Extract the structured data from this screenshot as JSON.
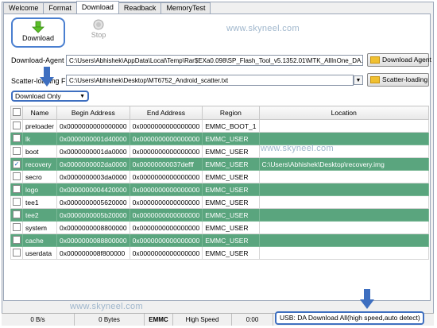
{
  "tabs": [
    "Welcome",
    "Format",
    "Download",
    "Readback",
    "MemoryTest"
  ],
  "active_tab": "Download",
  "toolbar": {
    "download_label": "Download",
    "stop_label": "Stop"
  },
  "watermark": "www.skyneel.com",
  "download_agent": {
    "label": "Download-Agent",
    "value": "C:\\Users\\Abhishek\\AppData\\Local\\Temp\\Rar$EXa0.098\\SP_Flash_Tool_v5.1352.01\\MTK_AllInOne_DA.bin",
    "button": "Download Agent"
  },
  "scatter": {
    "label": "Scatter-loading File",
    "value": "C:\\Users\\Abhishek\\Desktop\\MT6752_Android_scatter.txt",
    "button": "Scatter-loading"
  },
  "mode_select": {
    "value": "Download Only"
  },
  "table": {
    "headers": [
      "",
      "Name",
      "Begin Address",
      "End Address",
      "Region",
      "Location"
    ],
    "rows": [
      {
        "checked": false,
        "highlight": false,
        "name": "preloader",
        "begin": "0x0000000000000000",
        "end": "0x0000000000000000",
        "region": "EMMC_BOOT_1",
        "location": ""
      },
      {
        "checked": false,
        "highlight": true,
        "name": "lk",
        "begin": "0x0000000001d40000",
        "end": "0x0000000000000000",
        "region": "EMMC_USER",
        "location": ""
      },
      {
        "checked": false,
        "highlight": false,
        "name": "boot",
        "begin": "0x0000000001da0000",
        "end": "0x0000000000000000",
        "region": "EMMC_USER",
        "location": ""
      },
      {
        "checked": true,
        "highlight": true,
        "name": "recovery",
        "begin": "0x0000000002da0000",
        "end": "0x00000000037defff",
        "region": "EMMC_USER",
        "location": "C:\\Users\\Abhishek\\Desktop\\recovery.img"
      },
      {
        "checked": false,
        "highlight": false,
        "name": "secro",
        "begin": "0x0000000003da0000",
        "end": "0x0000000000000000",
        "region": "EMMC_USER",
        "location": ""
      },
      {
        "checked": false,
        "highlight": true,
        "name": "logo",
        "begin": "0x0000000004420000",
        "end": "0x0000000000000000",
        "region": "EMMC_USER",
        "location": ""
      },
      {
        "checked": false,
        "highlight": false,
        "name": "tee1",
        "begin": "0x0000000005620000",
        "end": "0x0000000000000000",
        "region": "EMMC_USER",
        "location": ""
      },
      {
        "checked": false,
        "highlight": true,
        "name": "tee2",
        "begin": "0x0000000005b20000",
        "end": "0x0000000000000000",
        "region": "EMMC_USER",
        "location": ""
      },
      {
        "checked": false,
        "highlight": false,
        "name": "system",
        "begin": "0x0000000008800000",
        "end": "0x0000000000000000",
        "region": "EMMC_USER",
        "location": ""
      },
      {
        "checked": false,
        "highlight": true,
        "name": "cache",
        "begin": "0x0000000088800000",
        "end": "0x0000000000000000",
        "region": "EMMC_USER",
        "location": ""
      },
      {
        "checked": false,
        "highlight": false,
        "name": "userdata",
        "begin": "0x000000008f800000",
        "end": "0x0000000000000000",
        "region": "EMMC_USER",
        "location": ""
      }
    ]
  },
  "status": {
    "rate": "0 B/s",
    "bytes": "0 Bytes",
    "storage": "EMMC",
    "speed": "High Speed",
    "time": "0:00",
    "usb": "USB: DA Download All(high speed,auto detect)"
  },
  "colors": {
    "highlight_row": "#5aa57e",
    "annotation_blue": "#3e6fc0"
  }
}
